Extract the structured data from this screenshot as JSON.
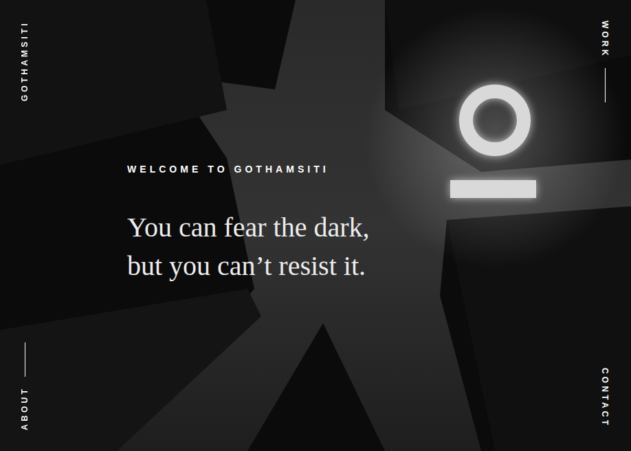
{
  "brand": "GOTHAMSITI",
  "nav": {
    "work": "WORK",
    "about": "ABOUT",
    "contact": "CONTACT"
  },
  "hero": {
    "eyebrow": "WELCOME TO GOTHAMSITI",
    "headline": [
      "You can fear the dark,",
      "but you can’t resist it."
    ]
  }
}
